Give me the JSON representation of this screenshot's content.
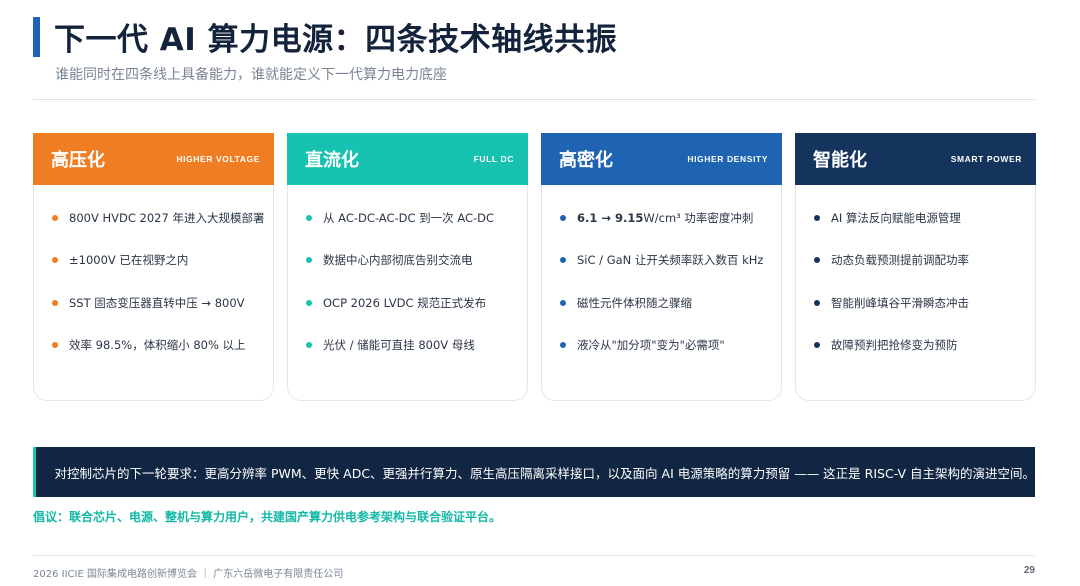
{
  "header": {
    "title": "下一代 AI 算力电源：四条技术轴线共振",
    "subtitle": "谁能同时在四条线上具备能力，谁就能定义下一代算力电力底座"
  },
  "colors": {
    "accent_bar": "#1f62b8",
    "high_voltage": "#f07d22",
    "full_dc": "#17c2b1",
    "high_density": "#1f63b3",
    "smart_power": "#14345e",
    "banner": "#102642",
    "call_to_action": "#14b8a6"
  },
  "columns": [
    {
      "name": "高压化",
      "tag": "HIGHER VOLTAGE",
      "items": [
        "800V HVDC 2027 年进入大规模部署",
        "±1000V 已在视野之内",
        "SST 固态变压器直转中压 → 800V",
        "效率 98.5%，体积缩小 80% 以上"
      ]
    },
    {
      "name": "直流化",
      "tag": "FULL DC",
      "items": [
        "从 AC-DC-AC-DC 到一次 AC-DC",
        "数据中心内部彻底告别交流电",
        "OCP 2026 LVDC 规范正式发布",
        "光伏 / 储能可直挂 800V 母线"
      ]
    },
    {
      "name": "高密化",
      "tag": "HIGHER DENSITY",
      "item0_bold": "6.1 → 9.15",
      "item0_rest": " W/cm³ 功率密度冲刺",
      "items": [
        "",
        "SiC / GaN 让开关频率跃入数百 kHz",
        "磁性元件体积随之骤缩",
        "液冷从\"加分项\"变为\"必需项\""
      ]
    },
    {
      "name": "智能化",
      "tag": "SMART POWER",
      "items": [
        "AI 算法反向赋能电源管理",
        "动态负载预测提前调配功率",
        "智能削峰填谷平滑瞬态冲击",
        "故障预判把抢修变为预防"
      ]
    }
  ],
  "banner": {
    "text": "对控制芯片的下一轮要求：更高分辨率 PWM、更快 ADC、更强并行算力、原生高压隔离采样接口，以及面向 AI 电源策略的算力预留 —— 这正是 RISC-V 自主架构的演进空间。"
  },
  "call_to_action": "倡议：联合芯片、电源、整机与算力用户，共建国产算力供电参考架构与联合验证平台。",
  "footer": {
    "text": "2026 IICIE 国际集成电路创新博览会 ｜ 广东六岳微电子有限责任公司",
    "page": "29"
  }
}
